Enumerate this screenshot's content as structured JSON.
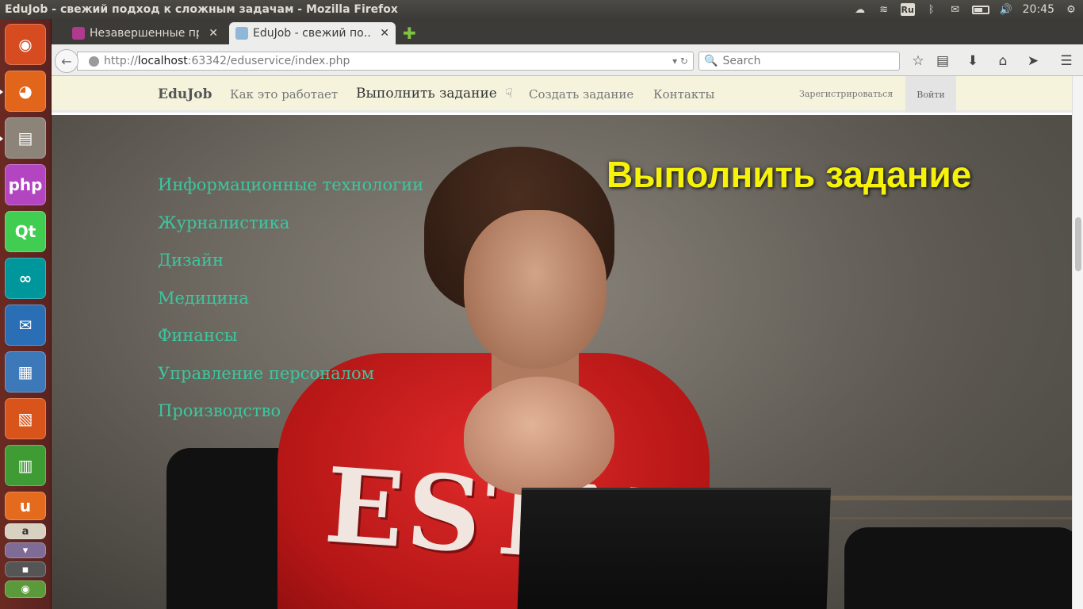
{
  "window": {
    "title": "EduJob - свежий подход к сложным задачам - Mozilla Firefox"
  },
  "system_tray": {
    "keyboard_layout": "Ru",
    "clock": "20:45"
  },
  "launcher": {
    "apps": [
      {
        "name": "ubuntu-dash",
        "color": "#d64c20",
        "glyph": "◉"
      },
      {
        "name": "firefox",
        "color": "#e2651c",
        "glyph": "🦊"
      },
      {
        "name": "files",
        "color": "#8c8478",
        "glyph": "▤"
      },
      {
        "name": "phpstorm",
        "color": "#b345c1",
        "glyph": "php"
      },
      {
        "name": "qt-creator",
        "color": "#41cd52",
        "glyph": "Qt"
      },
      {
        "name": "arduino",
        "color": "#00979c",
        "glyph": "∞"
      },
      {
        "name": "thunderbird",
        "color": "#2a6fb6",
        "glyph": "✉"
      },
      {
        "name": "writer",
        "color": "#3d78b8",
        "glyph": "▦"
      },
      {
        "name": "impress",
        "color": "#d9541a",
        "glyph": "▧"
      },
      {
        "name": "calc",
        "color": "#3f9c35",
        "glyph": "▥"
      },
      {
        "name": "software-center",
        "color": "#e46a1e",
        "glyph": "u"
      }
    ]
  },
  "tabs": [
    {
      "label": "Незавершенные пр…",
      "active": false,
      "favicon_color": "#b03a8e"
    },
    {
      "label": "EduJob - свежий по…",
      "active": true,
      "favicon_color": "#8fb7d8"
    }
  ],
  "navbar": {
    "url_scheme": "http://",
    "url_host": "localhost",
    "url_rest": ":63342/eduservice/index.php",
    "search_placeholder": "Search"
  },
  "site": {
    "brand": "EduJob",
    "nav": {
      "how_it_works": "Как это работает",
      "do_task": "Выполнить задание",
      "create_task": "Создать задание",
      "contacts": "Контакты",
      "register": "Зарегистрироваться",
      "login": "Войти"
    },
    "hero": {
      "title": "Выполнить задание",
      "shirt_text": "ESTN",
      "categories": [
        "Информационные технологии",
        "Журналистика",
        "Дизайн",
        "Медицина",
        "Финансы",
        "Управление персоналом",
        "Производство"
      ]
    }
  },
  "colors": {
    "hero_title": "#f6f20a",
    "category_link": "#3cc7a0",
    "site_nav_bg": "#f6f3dd"
  }
}
